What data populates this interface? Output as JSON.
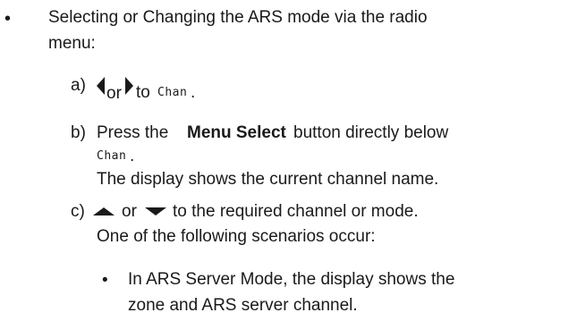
{
  "bullet_main": {
    "symbol": "•",
    "line1": "Selecting or Changing the ARS mode via the radio",
    "line2": "menu:"
  },
  "step_a": {
    "marker": "a)",
    "or_text": "or",
    "to_text": "to",
    "lcd_word": "Chan",
    "period": ".",
    "left_icon": "left-arrow-icon",
    "right_icon": "right-arrow-icon"
  },
  "step_b": {
    "marker": "b)",
    "prefix": "Press the",
    "button_name": "Menu Select",
    "suffix": "button directly below",
    "lcd_word": "Chan",
    "period": ".",
    "result": "The display shows the current channel name."
  },
  "step_c": {
    "marker": "c)",
    "or_text": "or",
    "action": "to the required channel or mode.",
    "result": "One of the following scenarios occur:",
    "up_icon": "up-arrow-icon",
    "down_icon": "down-arrow-icon"
  },
  "sub_bullet": {
    "symbol": "•",
    "line1": "In ARS Server Mode, the display shows the",
    "line2": "zone and ARS server channel."
  }
}
